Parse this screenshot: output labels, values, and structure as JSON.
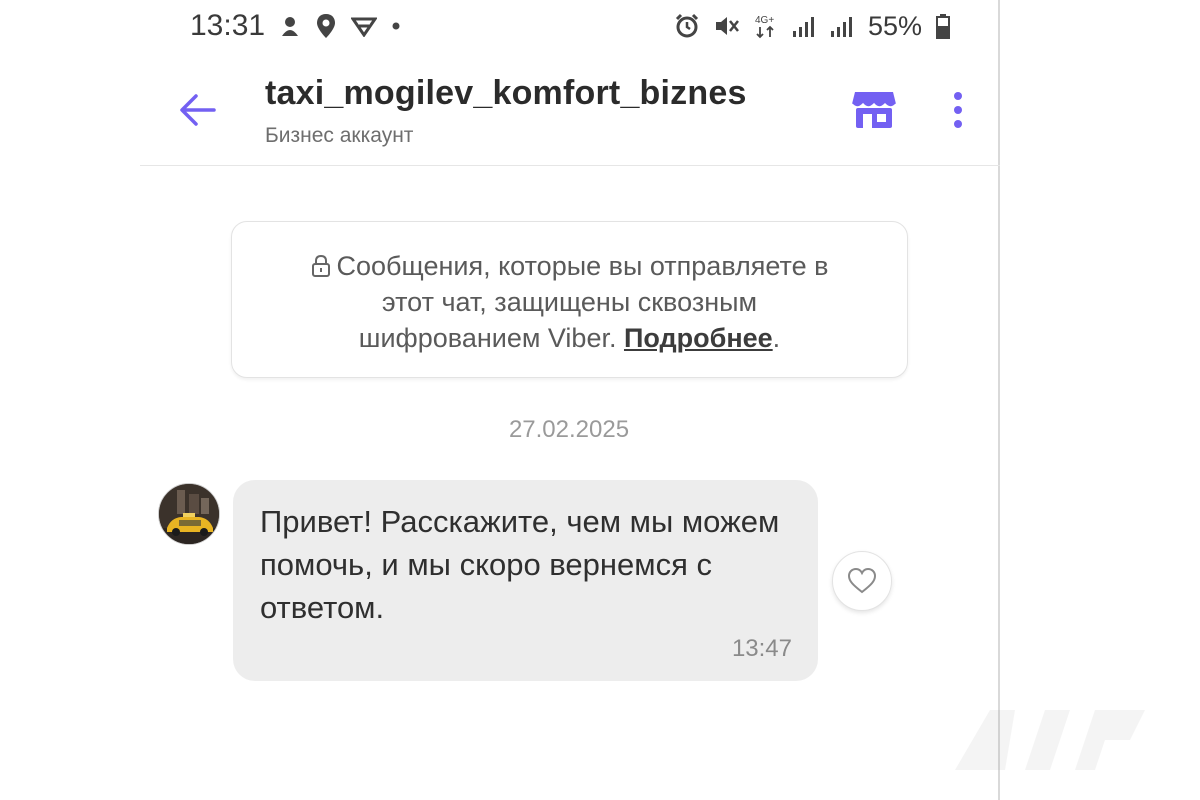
{
  "status_bar": {
    "time": "13:31",
    "network": "4G+",
    "battery": "55%",
    "left_icons": [
      "notification-icon",
      "location-icon",
      "vpn-icon",
      "dot-icon"
    ],
    "right_icons": [
      "alarm-icon",
      "mute-icon",
      "network-icon",
      "signal-icon",
      "signal-icon",
      "battery-icon"
    ]
  },
  "header": {
    "title": "taxi_mogilev_komfort_biznes",
    "subtitle": "Бизнес аккаунт",
    "back_icon": "arrow-left-icon",
    "shop_icon": "shop-icon",
    "more_icon": "more-vertical-icon",
    "accent_color": "#7360f2"
  },
  "notice": {
    "line1": "Сообщения, которые вы отправляете в",
    "line2": "этот чат, защищены сквозным",
    "line3_prefix": "шифрованием Viber. ",
    "link": "Подробнее",
    "line3_suffix": "."
  },
  "chat": {
    "date": "27.02.2025",
    "messages": [
      {
        "text": "Привет! Расскажите, чем мы можем помочь, и мы скоро вернемся с ответом.",
        "time": "13:47"
      }
    ]
  }
}
